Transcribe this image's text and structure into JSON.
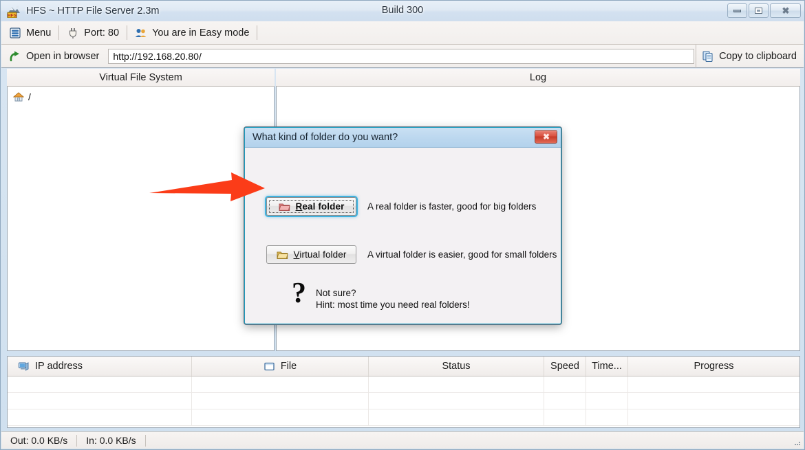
{
  "window": {
    "title": "HFS ~ HTTP File Server 2.3m",
    "build": "Build 300",
    "app_icon_name": "hfs-app-icon",
    "controls": {
      "minimize": "Minimize",
      "restore": "Restore",
      "close": "Close"
    }
  },
  "toolbar": {
    "menu_label": "Menu",
    "port_label": "Port: 80",
    "mode_label": "You are in Easy mode",
    "open_in_browser_label": "Open in browser",
    "copy_to_clipboard_label": "Copy to clipboard"
  },
  "address": {
    "url_value": "http://192.168.20.80/",
    "url_placeholder": "http://"
  },
  "panels": {
    "vfs_title": "Virtual File System",
    "log_title": "Log",
    "vfs_root_label": "/",
    "log_content": ""
  },
  "connections": {
    "columns": [
      {
        "label": "IP address",
        "icon": "computer-icon"
      },
      {
        "label": "File",
        "icon": "file-window-icon"
      },
      {
        "label": "Status",
        "icon": ""
      },
      {
        "label": "Speed",
        "icon": ""
      },
      {
        "label": "Time...",
        "icon": ""
      },
      {
        "label": "Progress",
        "icon": ""
      }
    ],
    "rows": []
  },
  "status_bar": {
    "out_label": "Out: 0.0 KB/s",
    "in_label": "In: 0.0 KB/s"
  },
  "dialog": {
    "title": "What kind of folder do you want?",
    "close_label": "Close",
    "options": [
      {
        "button_label_prefix": "",
        "button_accel": "R",
        "button_label_rest": "eal folder",
        "button_full": "Real folder",
        "description": "A real folder is faster, good for big folders",
        "icon": "red-folder-icon",
        "is_default": true
      },
      {
        "button_label_prefix": "",
        "button_accel": "V",
        "button_label_rest": "irtual folder",
        "button_full": "Virtual folder",
        "description": "A virtual folder is easier, good for small folders",
        "icon": "yellow-folder-icon",
        "is_default": false
      }
    ],
    "hint": {
      "glyph": "?",
      "line1": "Not sure?",
      "line2": "Hint: most time you need real folders!"
    }
  },
  "annotation": {
    "arrow_name": "red-pointer-arrow",
    "arrow_color": "#FB3C18",
    "points_to": "Real folder"
  },
  "colors": {
    "accent_blue": "#3fb3e0",
    "dialog_border": "#1d9bbd",
    "title_gradient_top": "#e8f0f8",
    "arrow_red": "#FB3C18",
    "close_red": "#c73a28"
  }
}
